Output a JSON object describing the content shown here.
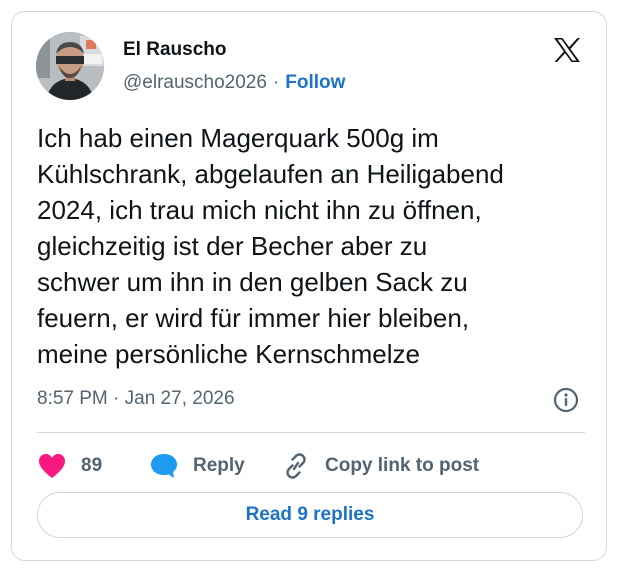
{
  "author": {
    "name": "El Rauscho",
    "handle": "@elrauscho2026",
    "separator": "·",
    "follow_label": "Follow"
  },
  "tweet": {
    "text": "Ich hab einen Magerquark 500g im\nKühlschrank, abgelaufen an Heiligabend\n2024, ich trau mich nicht ihn zu öffnen,\ngleichzeitig ist der Becher aber zu\nschwer um ihn in den gelben Sack zu\nfeuern, er wird für immer hier bleiben,\nmeine persönliche Kernschmelze",
    "timestamp": "8:57 PM · Jan 27, 2026"
  },
  "actions": {
    "like_count": "89",
    "reply_label": "Reply",
    "copy_label": "Copy link to post"
  },
  "read_replies_label": "Read 9 replies",
  "icons": {
    "brand": "x-logo-icon",
    "info": "info-icon",
    "like": "heart-icon",
    "reply": "speech-bubble-icon",
    "copy": "link-icon"
  },
  "colors": {
    "heart": "#f91880",
    "reply_bubble": "#1d9bf0",
    "link_blue": "#1d74c4",
    "muted_text": "#536471",
    "border": "#cfd9de"
  }
}
